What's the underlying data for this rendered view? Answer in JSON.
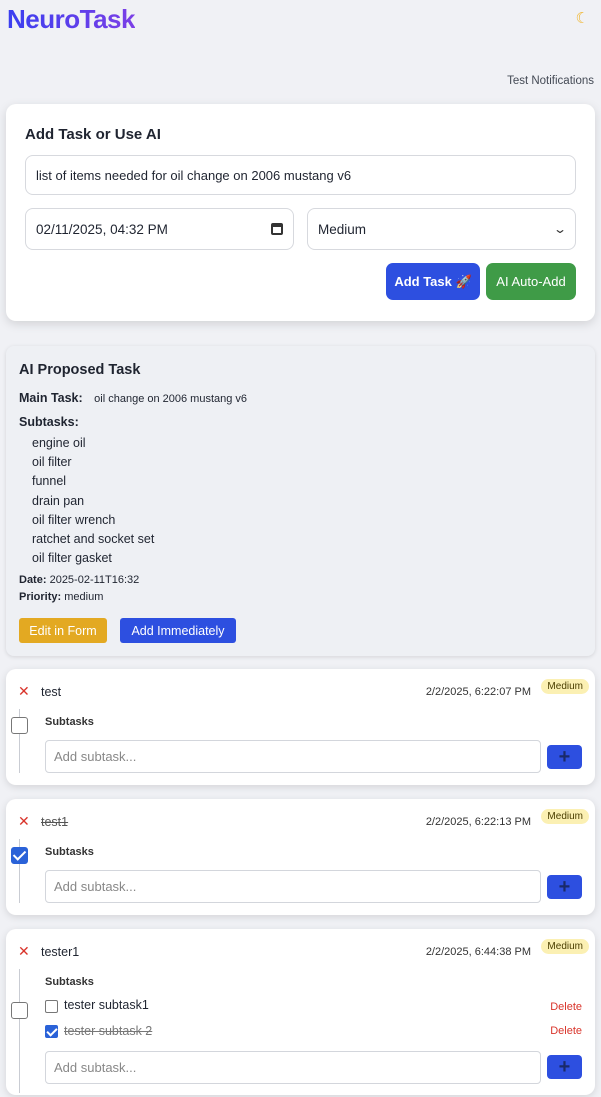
{
  "app": {
    "logo": "NeuroTask",
    "theme_icon": "moon-icon",
    "test_notifications": "Test Notifications"
  },
  "add_task": {
    "heading": "Add Task or Use AI",
    "input_value": "list of items needed for oil change on 2006 mustang v6",
    "date_value": "02/11/2025, 04:32 PM",
    "priority_value": "Medium",
    "add_button": "Add Task 🚀",
    "ai_button": "AI Auto-Add"
  },
  "ai_proposed": {
    "heading": "AI Proposed Task",
    "main_label": "Main Task:",
    "main_value": "oil change on 2006 mustang v6",
    "subtasks_label": "Subtasks:",
    "subtasks": [
      "engine oil",
      "oil filter",
      "funnel",
      "drain pan",
      "oil filter wrench",
      "ratchet and socket set",
      "oil filter gasket"
    ],
    "date_label": "Date:",
    "date_value": "2025-02-11T16:32",
    "priority_label": "Priority:",
    "priority_value": "medium",
    "edit_button": "Edit in Form",
    "add_now_button": "Add Immediately"
  },
  "tasks": [
    {
      "title": "test",
      "time": "2/2/2025, 6:22:07 PM",
      "priority": "Medium",
      "completed": false,
      "subtasks_label": "Subtasks",
      "placeholder": "Add subtask...",
      "add_icon": "+"
    },
    {
      "title": "test1",
      "time": "2/2/2025, 6:22:13 PM",
      "priority": "Medium",
      "completed": true,
      "subtasks_label": "Subtasks",
      "placeholder": "Add subtask...",
      "add_icon": "+"
    },
    {
      "title": "tester1",
      "time": "2/2/2025, 6:44:38 PM",
      "priority": "Medium",
      "completed": false,
      "subtasks_label": "Subtasks",
      "placeholder": "Add subtask...",
      "add_icon": "+",
      "subtasks": [
        {
          "text": "tester subtask1",
          "done": false,
          "delete_label": "Delete"
        },
        {
          "text": "tester subtask 2",
          "done": true,
          "delete_label": "Delete"
        }
      ]
    }
  ]
}
